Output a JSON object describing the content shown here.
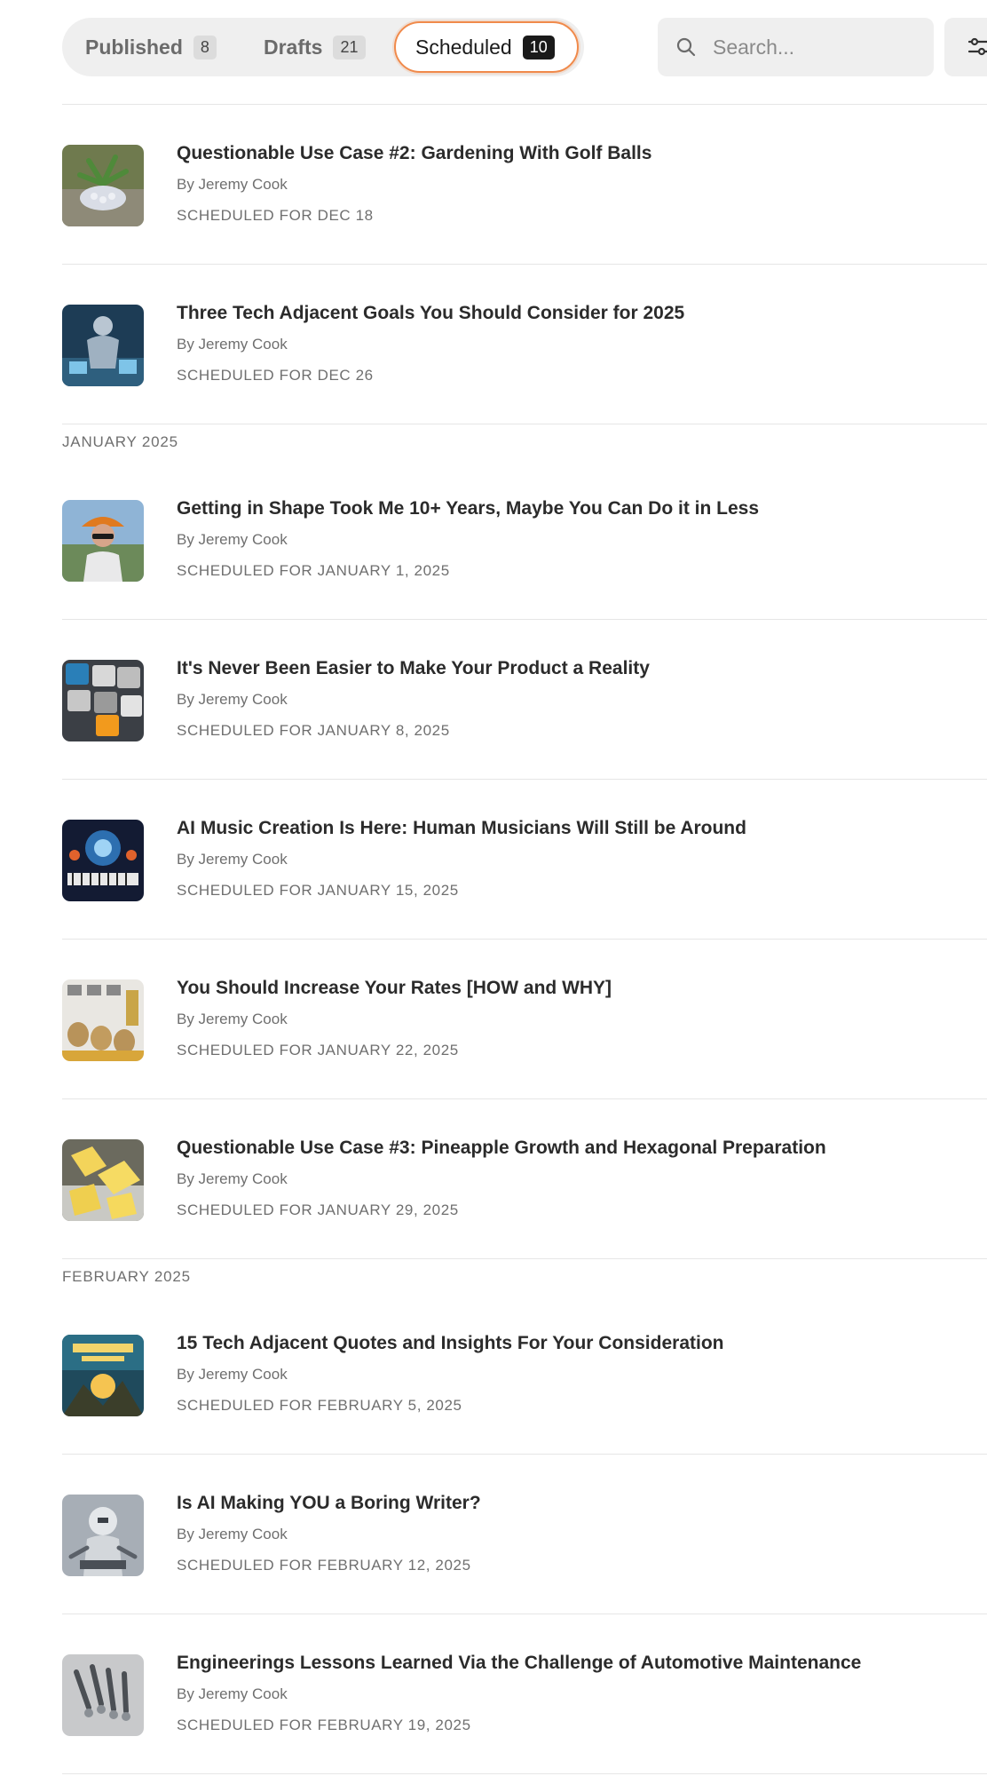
{
  "tabs": [
    {
      "label": "Published",
      "count": "8"
    },
    {
      "label": "Drafts",
      "count": "21"
    },
    {
      "label": "Scheduled",
      "count": "10"
    }
  ],
  "search": {
    "placeholder": "Search..."
  },
  "icons": {
    "search": "search-icon",
    "filter": "filter-sliders-icon"
  },
  "colors": {
    "active_tab_border": "#f08a4b",
    "active_count_bg": "#1a1a1a"
  },
  "months": [
    "JANUARY 2025",
    "FEBRUARY 2025"
  ],
  "posts": [
    {
      "title": "Questionable Use Case #2: Gardening With Golf Balls",
      "author": "By Jeremy Cook",
      "scheduled": "SCHEDULED FOR DEC 18"
    },
    {
      "title": "Three Tech Adjacent Goals You Should Consider for 2025",
      "author": "By Jeremy Cook",
      "scheduled": "SCHEDULED FOR DEC 26"
    },
    {
      "title": "Getting in Shape Took Me 10+ Years, Maybe You Can Do it in Less",
      "author": "By Jeremy Cook",
      "scheduled": "SCHEDULED FOR JANUARY 1, 2025"
    },
    {
      "title": "It's Never Been Easier to Make Your Product a Reality",
      "author": "By Jeremy Cook",
      "scheduled": "SCHEDULED FOR JANUARY 8, 2025"
    },
    {
      "title": "AI Music Creation Is Here: Human Musicians Will Still be Around",
      "author": "By Jeremy Cook",
      "scheduled": "SCHEDULED FOR JANUARY 15, 2025"
    },
    {
      "title": "You Should Increase Your Rates [HOW and WHY]",
      "author": "By Jeremy Cook",
      "scheduled": "SCHEDULED FOR JANUARY 22, 2025"
    },
    {
      "title": "Questionable Use Case #3: Pineapple Growth and Hexagonal Preparation",
      "author": "By Jeremy Cook",
      "scheduled": "SCHEDULED FOR JANUARY 29, 2025"
    },
    {
      "title": "15 Tech Adjacent Quotes and Insights For Your Consideration",
      "author": "By Jeremy Cook",
      "scheduled": "SCHEDULED FOR FEBRUARY 5, 2025"
    },
    {
      "title": "Is AI Making YOU a Boring Writer?",
      "author": "By Jeremy Cook",
      "scheduled": "SCHEDULED FOR FEBRUARY 12, 2025"
    },
    {
      "title": "Engineerings Lessons Learned Via the Challenge of Automotive Maintenance",
      "author": "By Jeremy Cook",
      "scheduled": "SCHEDULED FOR FEBRUARY 19, 2025"
    }
  ]
}
